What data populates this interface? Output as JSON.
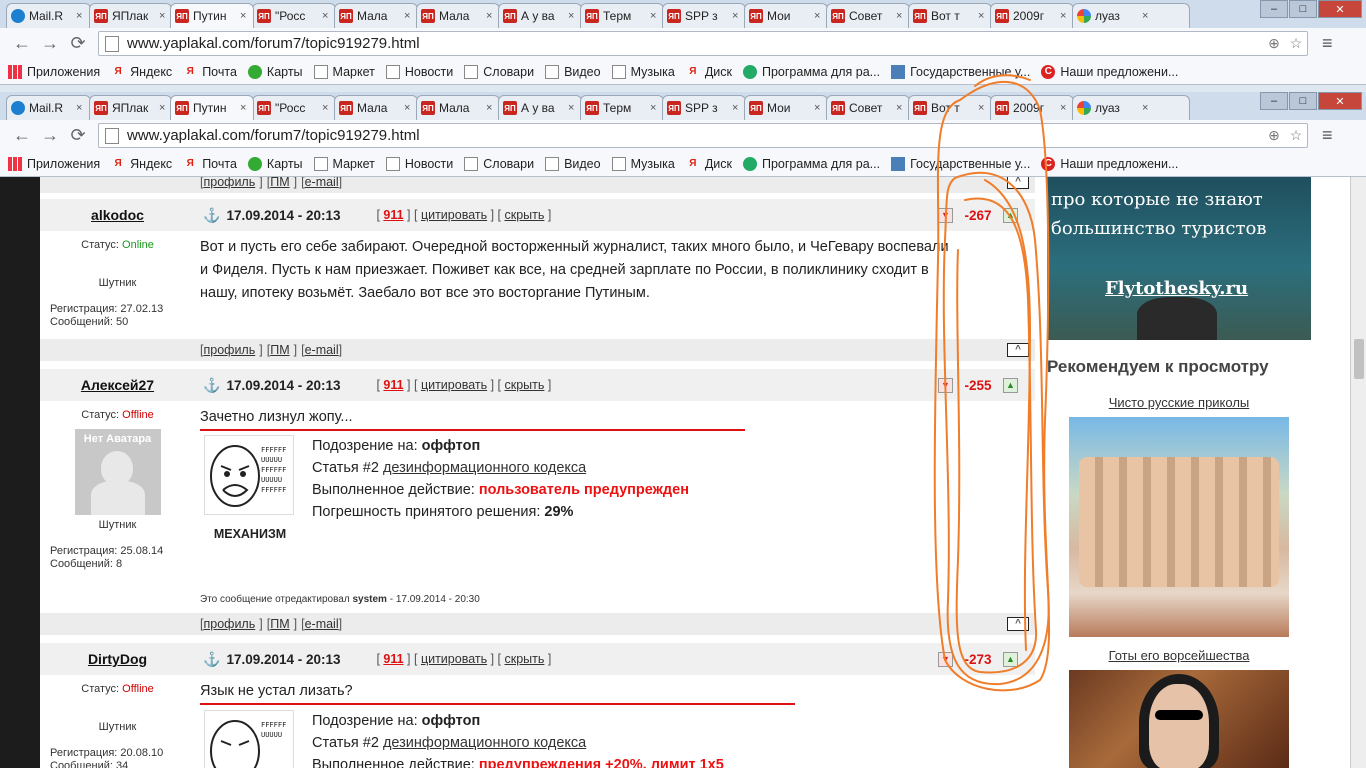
{
  "tabs": [
    {
      "label": "Mail.R",
      "icon": "mail"
    },
    {
      "label": "ЯПлак",
      "icon": "yap"
    },
    {
      "label": "Путин",
      "icon": "yap",
      "active": true
    },
    {
      "label": "\"Росс",
      "icon": "yap"
    },
    {
      "label": "Мала",
      "icon": "yap"
    },
    {
      "label": "Мала",
      "icon": "yap"
    },
    {
      "label": "А у ва",
      "icon": "yap"
    },
    {
      "label": "Терм",
      "icon": "yap"
    },
    {
      "label": "SPP з",
      "icon": "yap"
    },
    {
      "label": "Мои",
      "icon": "yap"
    },
    {
      "label": "Совет",
      "icon": "yap"
    },
    {
      "label": "Вот т",
      "icon": "yap"
    },
    {
      "label": "2009г",
      "icon": "yap"
    },
    {
      "label": "луаз",
      "icon": "google"
    }
  ],
  "url": "www.yaplakal.com/forum7/topic919279.html",
  "bookmarks": [
    {
      "label": "Приложения",
      "icon": "apps"
    },
    {
      "label": "Яндекс",
      "icon": "ya"
    },
    {
      "label": "Почта",
      "icon": "ya"
    },
    {
      "label": "Карты",
      "icon": "maps"
    },
    {
      "label": "Маркет",
      "icon": "doc"
    },
    {
      "label": "Новости",
      "icon": "doc"
    },
    {
      "label": "Словари",
      "icon": "doc"
    },
    {
      "label": "Видео",
      "icon": "doc"
    },
    {
      "label": "Музыка",
      "icon": "doc"
    },
    {
      "label": "Диск",
      "icon": "ya"
    },
    {
      "label": "Программа для ра...",
      "icon": "globe"
    },
    {
      "label": "Государственные у...",
      "icon": "gov"
    },
    {
      "label": "Наши предложени...",
      "icon": "red"
    }
  ],
  "top_links": {
    "profile": "профиль",
    "pm": "ПМ",
    "email": "e-mail"
  },
  "post_actions": {
    "quote": "цитировать",
    "hide": "скрыть",
    "num": "911"
  },
  "posts": [
    {
      "author": "alkodoc",
      "date": "17.09.2014 - 20:13",
      "rating": "-267",
      "status_label": "Статус:",
      "status": "Online",
      "rank": "Шутник",
      "registration": "Регистрация: 27.02.13",
      "messages": "Сообщений: 50",
      "text": "Вот и пусть его себе забирают. Очередной восторженный журналист, таких много было, и ЧеГевару воспевали и Фиделя. Пусть к нам приезжает. Поживет как все, на средней зарплате по России, в поликлинику сходит в нашу, ипотеку возьмёт. Заебало вот все это восторгание Путиным."
    },
    {
      "author": "Алексей27",
      "date": "17.09.2014 - 20:13",
      "rating": "-255",
      "status_label": "Статус:",
      "status": "Offline",
      "avatar_text": "Нет Аватара",
      "rank": "Шутник",
      "registration": "Регистрация: 25.08.14",
      "messages": "Сообщений: 8",
      "quote": "Зачетно лизнул жопу...",
      "mod": {
        "caption": "МЕХАНИЗМ",
        "suspicion_label": "Подозрение на:",
        "suspicion": "оффтоп",
        "article_label": "Статья #2",
        "article": "дезинформационного кодекса",
        "action_label": "Выполненное действие:",
        "action": "пользователь предупрежден",
        "error_label": "Погрешность принятого решения:",
        "error": "29%"
      },
      "edited_prefix": "Это сообщение отредактировал",
      "edited_by": "system",
      "edited_suffix": "- 17.09.2014 - 20:30"
    },
    {
      "author": "DirtyDog",
      "date": "17.09.2014 - 20:13",
      "rating": "-273",
      "status_label": "Статус:",
      "status": "Offline",
      "rank": "Шутник",
      "registration": "Регистрация: 20.08.10",
      "messages": "Сообщений: 34",
      "quote": "Язык не устал лизать?",
      "mod": {
        "suspicion_label": "Подозрение на:",
        "suspicion": "оффтоп",
        "article_label": "Статья #2",
        "article": "дезинформационного кодекса",
        "action_label": "Выполненное действие:",
        "action": "предупреждения +20%, лимит 1х5"
      }
    }
  ],
  "sidebar": {
    "ad_line1": "про которые не знают",
    "ad_line2": "большинство туристов",
    "ad_site": "Flytothesky.ru",
    "recommend_title": "Рекомендуем к просмотру",
    "rec1": "Чисто русские приколы",
    "rec2": "Готы его ворсейшества"
  },
  "colors": {
    "accent_red": "#dd1111",
    "online": "#1a9a1a",
    "scribble": "#f07d2a"
  }
}
